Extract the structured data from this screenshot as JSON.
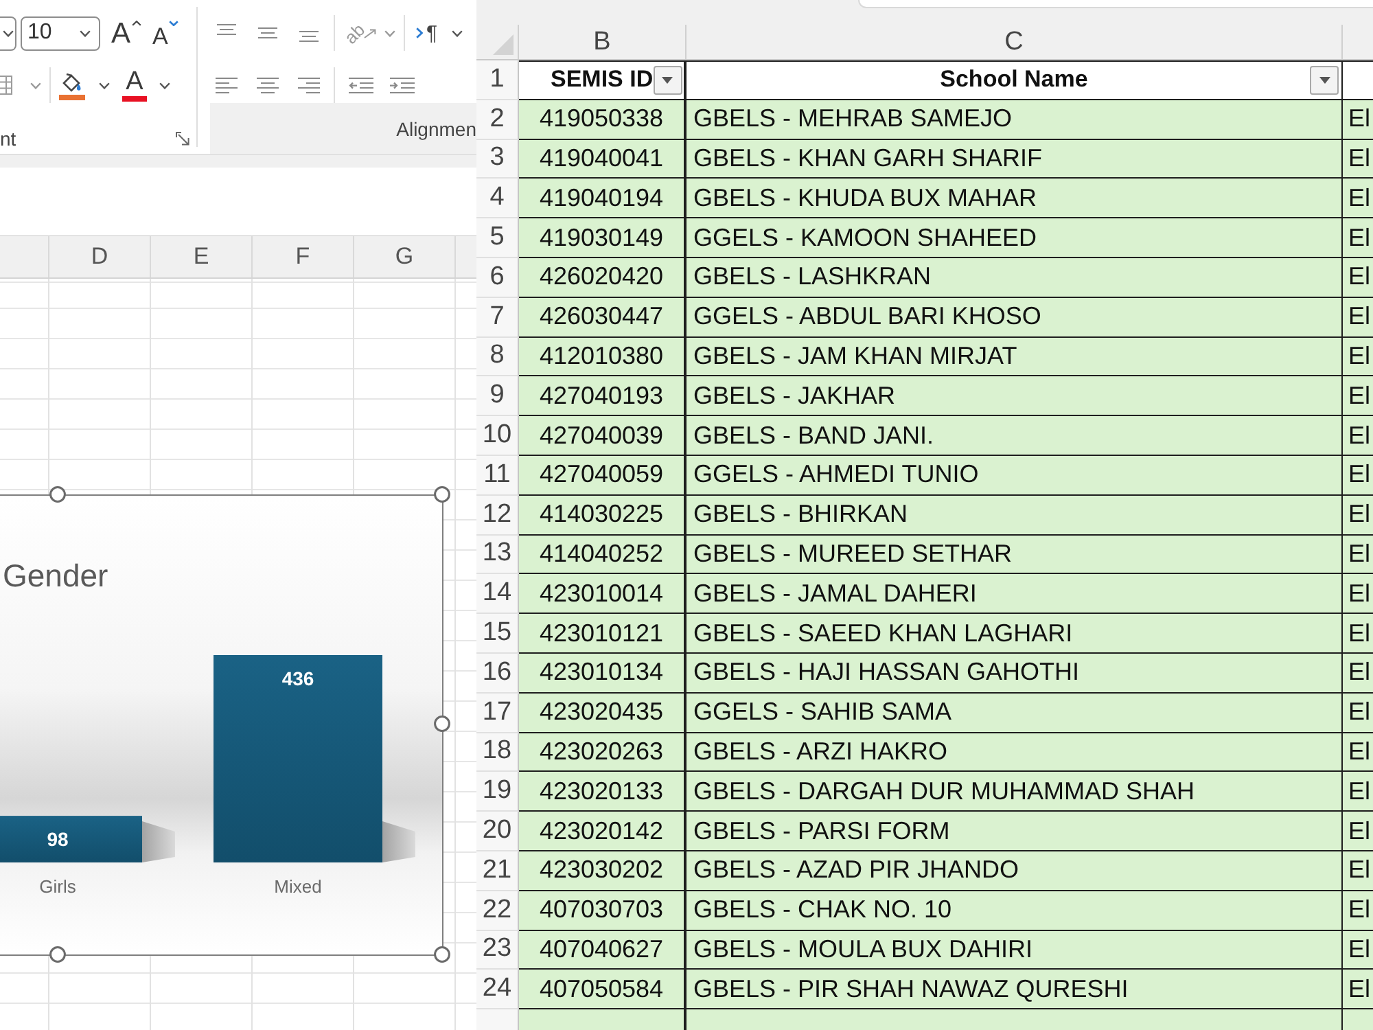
{
  "ribbon": {
    "font_group": {
      "label": "nt",
      "font_size": "10",
      "grow_font": "A",
      "shrink_font": "A",
      "font_color": "A"
    },
    "alignment_group": {
      "label": "Alignmen",
      "orientation": "ab",
      "paragraph": "¶"
    }
  },
  "left_sheet": {
    "columns": [
      "D",
      "E",
      "F",
      "G"
    ],
    "chart": {
      "chart_data": {
        "type": "bar",
        "title": "Gender",
        "categories": [
          "Girls",
          "Mixed"
        ],
        "values": [
          98,
          436
        ],
        "data_labels": true
      }
    }
  },
  "right_sheet": {
    "columns": [
      "B",
      "C"
    ],
    "header_row": {
      "number": "1",
      "semis_id": "SEMIS ID",
      "school_name": "School Name"
    },
    "rows": [
      {
        "number": "2",
        "semis_id": "419050338",
        "school_name": "GBELS - MEHRAB SAMEJO",
        "column_3": "El"
      },
      {
        "number": "3",
        "semis_id": "419040041",
        "school_name": "GBELS - KHAN GARH SHARIF",
        "column_3": "El"
      },
      {
        "number": "4",
        "semis_id": "419040194",
        "school_name": "GBELS - KHUDA BUX MAHAR",
        "column_3": "El"
      },
      {
        "number": "5",
        "semis_id": "419030149",
        "school_name": "GGELS - KAMOON SHAHEED",
        "column_3": "El"
      },
      {
        "number": "6",
        "semis_id": "426020420",
        "school_name": "GBELS - LASHKRAN",
        "column_3": "El"
      },
      {
        "number": "7",
        "semis_id": "426030447",
        "school_name": "GGELS - ABDUL BARI KHOSO",
        "column_3": "El"
      },
      {
        "number": "8",
        "semis_id": "412010380",
        "school_name": "GBELS - JAM KHAN MIRJAT",
        "column_3": "El"
      },
      {
        "number": "9",
        "semis_id": "427040193",
        "school_name": "GBELS - JAKHAR",
        "column_3": "El"
      },
      {
        "number": "10",
        "semis_id": "427040039",
        "school_name": "GBELS - BAND JANI.",
        "column_3": "El"
      },
      {
        "number": "11",
        "semis_id": "427040059",
        "school_name": "GGELS - AHMEDI TUNIO",
        "column_3": "El"
      },
      {
        "number": "12",
        "semis_id": "414030225",
        "school_name": "GBELS - BHIRKAN",
        "column_3": "El"
      },
      {
        "number": "13",
        "semis_id": "414040252",
        "school_name": "GBELS - MUREED SETHAR",
        "column_3": "El"
      },
      {
        "number": "14",
        "semis_id": "423010014",
        "school_name": "GBELS - JAMAL DAHERI",
        "column_3": "El"
      },
      {
        "number": "15",
        "semis_id": "423010121",
        "school_name": "GBELS - SAEED KHAN LAGHARI",
        "column_3": "El"
      },
      {
        "number": "16",
        "semis_id": "423010134",
        "school_name": "GBELS - HAJI HASSAN GAHOTHI",
        "column_3": "El"
      },
      {
        "number": "17",
        "semis_id": "423020435",
        "school_name": "GGELS - SAHIB SAMA",
        "column_3": "El"
      },
      {
        "number": "18",
        "semis_id": "423020263",
        "school_name": "GBELS - ARZI HAKRO",
        "column_3": "El"
      },
      {
        "number": "19",
        "semis_id": "423020133",
        "school_name": "GBELS - DARGAH DUR MUHAMMAD SHAH",
        "column_3": "El"
      },
      {
        "number": "20",
        "semis_id": "423020142",
        "school_name": "GBELS - PARSI FORM",
        "column_3": "El"
      },
      {
        "number": "21",
        "semis_id": "423030202",
        "school_name": "GBELS - AZAD PIR JHANDO",
        "column_3": "El"
      },
      {
        "number": "22",
        "semis_id": "407030703",
        "school_name": "GBELS - CHAK NO. 10",
        "column_3": "El"
      },
      {
        "number": "23",
        "semis_id": "407040627",
        "school_name": "GBELS - MOULA BUX DAHIRI",
        "column_3": "El"
      },
      {
        "number": "24",
        "semis_id": "407050584",
        "school_name": "GBELS - PIR SHAH NAWAZ QURESHI",
        "column_3": "El"
      }
    ]
  }
}
